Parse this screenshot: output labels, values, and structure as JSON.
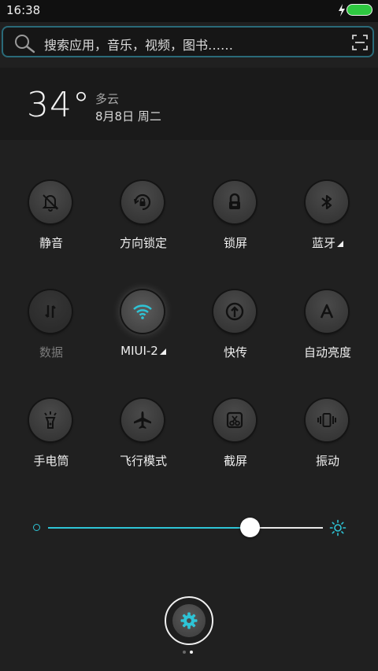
{
  "status_bar": {
    "time": "16:38"
  },
  "search": {
    "placeholder": "搜索应用，音乐，视频，图书……"
  },
  "weather": {
    "temperature": "34°",
    "condition": "多云",
    "date": "8月8日 周二"
  },
  "toggles": [
    {
      "label": "静音",
      "icon": "bell-off-icon",
      "state": "off"
    },
    {
      "label": "方向锁定",
      "icon": "rotation-lock-icon",
      "state": "off"
    },
    {
      "label": "锁屏",
      "icon": "lock-icon",
      "state": "off"
    },
    {
      "label": "蓝牙",
      "icon": "bluetooth-icon",
      "state": "off",
      "has_more": true
    },
    {
      "label": "数据",
      "icon": "mobile-data-icon",
      "state": "disabled"
    },
    {
      "label": "MIUI-2",
      "icon": "wifi-icon",
      "state": "on",
      "has_more": true
    },
    {
      "label": "快传",
      "icon": "quick-transfer-icon",
      "state": "off"
    },
    {
      "label": "自动亮度",
      "icon": "auto-brightness-icon",
      "state": "off"
    },
    {
      "label": "手电筒",
      "icon": "flashlight-icon",
      "state": "off"
    },
    {
      "label": "飞行模式",
      "icon": "airplane-icon",
      "state": "off"
    },
    {
      "label": "截屏",
      "icon": "screenshot-icon",
      "state": "off"
    },
    {
      "label": "振动",
      "icon": "vibrate-icon",
      "state": "off"
    }
  ],
  "brightness": {
    "level": 0.72
  },
  "pager": {
    "pages": 2,
    "current": 2
  },
  "colors": {
    "accent": "#2ec4d6",
    "background": "#202020"
  }
}
